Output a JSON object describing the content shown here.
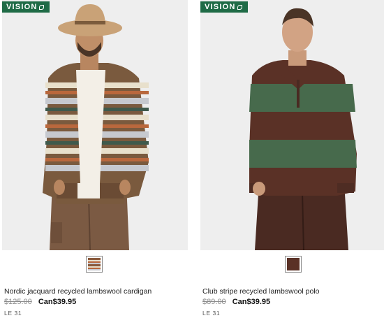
{
  "colors": {
    "badge_green": "#1f6b46",
    "photo_bg": "#eeeeee",
    "old_price": "#8c8c8c"
  },
  "products": [
    {
      "badge": "VISION",
      "name": "Nordic jacquard recycled lambswool cardigan",
      "old_price": "$125.00",
      "new_price": "Can$39.95",
      "code": "LE 31",
      "swatch_color": "#8a5a3c"
    },
    {
      "badge": "VISION",
      "name": "Club stripe recycled lambswool polo",
      "old_price": "$89.00",
      "new_price": "Can$39.95",
      "code": "LE 31",
      "swatch_color": "#5a3126"
    }
  ]
}
